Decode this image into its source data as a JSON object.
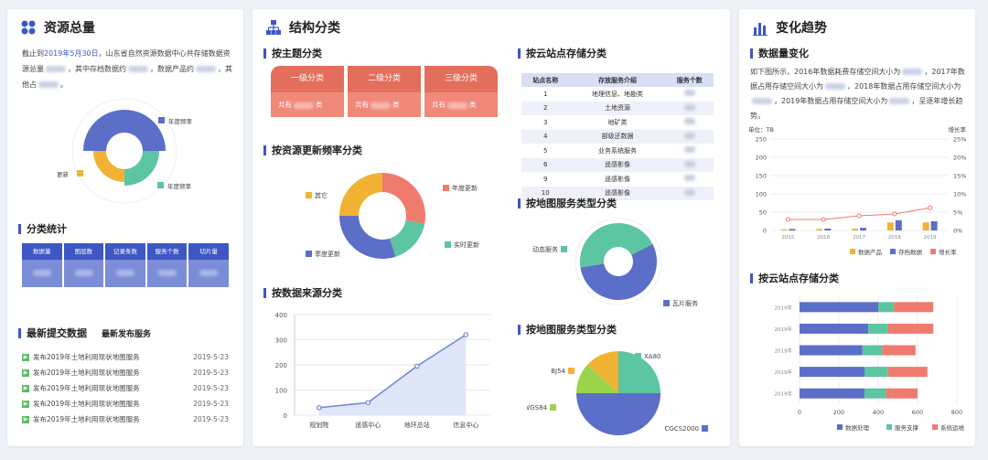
{
  "panel1": {
    "title": "资源总量",
    "intro": {
      "p1": "截止到",
      "date": "2019年5月30日",
      "p2": "，山东省自然资源数据中心共存储数据资源总量",
      "p3": "，其中存档数据约",
      "p4": "，数据产品约",
      "p5": "，其他占",
      "p6": "。"
    },
    "rose": {
      "labels": [
        "年度频率",
        "更新",
        "年度频率"
      ],
      "colors": [
        "#5b6ec8",
        "#f2b233",
        "#5cc5a1"
      ]
    },
    "category_title": "分类统计",
    "categories": [
      "数据量",
      "图层数",
      "记录条数",
      "服务个数",
      "切片量"
    ],
    "latest_title": "最新提交数据",
    "latest_tab": "最新发布服务",
    "news": [
      {
        "title": "发布2019年土地利用现状地图服务",
        "date": "2019-5-23"
      },
      {
        "title": "发布2019年土地利用现状地图服务",
        "date": "2019-5-23"
      },
      {
        "title": "发布2019年土地利用现状地图服务",
        "date": "2019-5-23"
      },
      {
        "title": "发布2019年土地利用现状地图服务",
        "date": "2019-5-23"
      },
      {
        "title": "发布2019年土地利用现状地图服务",
        "date": "2019-5-23"
      }
    ]
  },
  "panel2": {
    "title": "结构分类",
    "theme_title": "按主题分类",
    "tabs": [
      {
        "head": "一级分类",
        "prefix": "共有",
        "suffix": "类"
      },
      {
        "head": "二级分类",
        "prefix": "共有",
        "suffix": "类"
      },
      {
        "head": "三级分类",
        "prefix": "共有",
        "suffix": "类"
      }
    ],
    "freq_title": "按资源更新频率分类",
    "source_title": "按数据来源分类",
    "cloud_title": "按云站点存储分类",
    "cloud_table": {
      "headers": [
        "站点名称",
        "存放服务介绍",
        "服务个数"
      ],
      "rows": [
        {
          "id": "1",
          "desc": "地理信息、地勘类"
        },
        {
          "id": "2",
          "desc": "土地资源"
        },
        {
          "id": "3",
          "desc": "地矿类"
        },
        {
          "id": "4",
          "desc": "部级还数据"
        },
        {
          "id": "5",
          "desc": "业务系统服务"
        },
        {
          "id": "6",
          "desc": "遥感影像"
        },
        {
          "id": "9",
          "desc": "遥感影像"
        },
        {
          "id": "10",
          "desc": "遥感影像"
        }
      ]
    },
    "map_service_title": "按地图服务类型分类",
    "map_service_title2": "按地图服务类型分类"
  },
  "panel3": {
    "title": "变化趋势",
    "volume_title": "数据量变化",
    "intro": {
      "p1": "如下图所示，2016年数据耗费存储空间大小为",
      "p2": "，2017年数据占用存储空间大小为",
      "p3": "，2018年数据占用存储空间大小为",
      "p4": "，2019年数据占用存储空间大小为",
      "p5": "，呈逐年增长趋势。"
    },
    "cloud_title": "按云站点存储分类"
  },
  "chart_data": [
    {
      "type": "pie",
      "name": "rose",
      "labels": [
        "年度频率",
        "更新",
        "年度频率"
      ],
      "values": [
        50,
        20,
        30
      ]
    },
    {
      "type": "pie",
      "name": "update_frequency",
      "labels": [
        "年度更新",
        "实时更新",
        "季度更新",
        "其它"
      ],
      "values": [
        28,
        17,
        30,
        25
      ],
      "colors": [
        "#ef7b6e",
        "#5cc5a1",
        "#5b6ec8",
        "#f2b233"
      ]
    },
    {
      "type": "line",
      "name": "data_source",
      "categories": [
        "规划院",
        "遥感中心",
        "地环总站",
        "信息中心"
      ],
      "values": [
        30,
        50,
        195,
        320
      ],
      "ylim": [
        0,
        400
      ],
      "yticks": [
        0,
        100,
        200,
        300,
        400
      ],
      "color": "#6f86d6"
    },
    {
      "type": "pie",
      "name": "map_service_1",
      "labels": [
        "动态服务",
        "瓦片服务"
      ],
      "values": [
        45,
        55
      ],
      "colors": [
        "#5cc5a1",
        "#5b6ec8"
      ]
    },
    {
      "type": "pie",
      "name": "map_service_2",
      "labels": [
        "XA80",
        "CGCS2000",
        "WGS84",
        "BJ54"
      ],
      "values": [
        25,
        50,
        12,
        13
      ],
      "colors": [
        "#5cc5a1",
        "#5b6ec8",
        "#9bd44a",
        "#f2b233"
      ]
    },
    {
      "type": "bar",
      "name": "volume_change",
      "categories": [
        "2015",
        "2016",
        "2017",
        "2018",
        "2019"
      ],
      "ylabel_left": "单位：TB",
      "ylabel_right": "增长率",
      "ylim": [
        0,
        250
      ],
      "yticks": [
        0,
        50,
        100,
        150,
        200,
        250
      ],
      "y2ticks": [
        "0%",
        "5%",
        "10%",
        "15%",
        "20%",
        "25%"
      ],
      "series": [
        {
          "name": "数据产品",
          "values": [
            3,
            4,
            5,
            22,
            22
          ],
          "color": "#f2b233"
        },
        {
          "name": "存档数据",
          "values": [
            4,
            5,
            7,
            28,
            25
          ],
          "color": "#5b6ec8"
        },
        {
          "name": "增长率",
          "values": [
            3,
            3,
            4,
            4.5,
            6.2
          ],
          "color": "#ef7b6e"
        }
      ]
    },
    {
      "type": "bar",
      "name": "cloud_storage",
      "orientation": "horizontal",
      "categories": [
        "2019年",
        "2019年",
        "2019年",
        "2019年",
        "2019年"
      ],
      "xlim": [
        0,
        800
      ],
      "xticks": [
        0,
        200,
        400,
        600,
        800
      ],
      "series": [
        {
          "name": "数据处理",
          "values": [
            400,
            350,
            320,
            330,
            330
          ],
          "color": "#5b6ec8"
        },
        {
          "name": "服务支撑",
          "values": [
            80,
            100,
            100,
            120,
            110
          ],
          "color": "#5cc5a1"
        },
        {
          "name": "系统运维",
          "values": [
            200,
            230,
            170,
            200,
            160
          ],
          "color": "#ef7b6e"
        }
      ]
    }
  ]
}
